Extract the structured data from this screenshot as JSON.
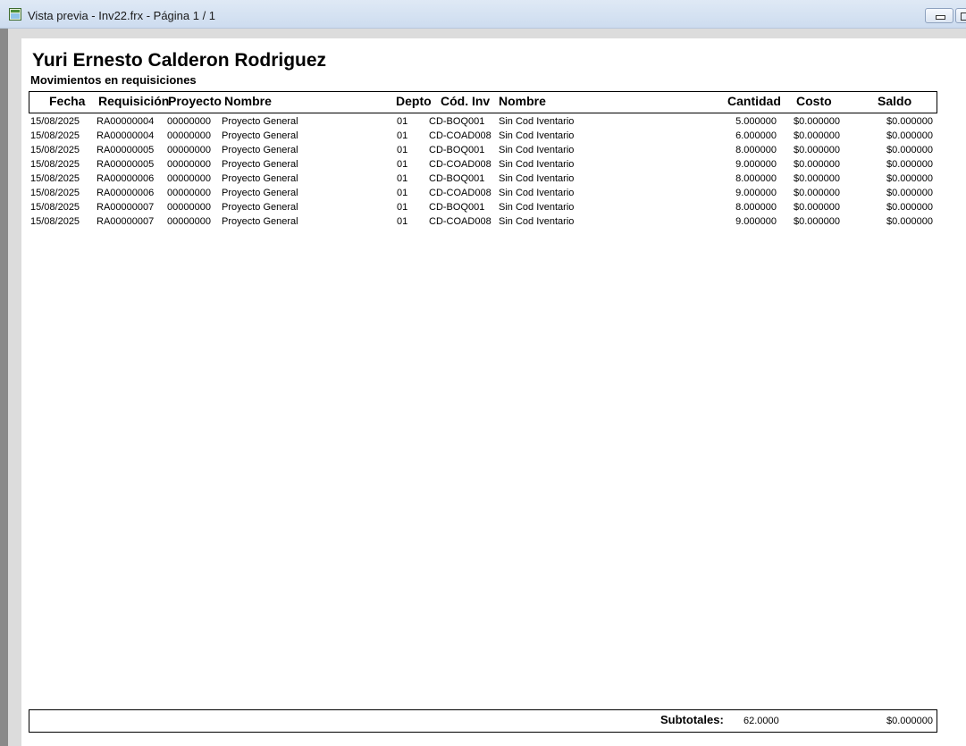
{
  "window": {
    "title": "Vista previa - Inv22.frx - Página 1 / 1",
    "app_icon": "report-icon",
    "frame_color": "#dcdcdc",
    "page_color": "#ffffff"
  },
  "report": {
    "title": "Yuri Ernesto Calderon Rodriguez",
    "subtitle": "Movimientos en requisiciones"
  },
  "columns": {
    "fecha": "Fecha",
    "requisicion": "Requisición",
    "proyecto": "Proyecto",
    "nombre": "Nombre",
    "depto": "Depto",
    "cod_inv": "Cód. Inv",
    "nombre2": "Nombre",
    "cantidad": "Cantidad",
    "costo": "Costo",
    "saldo": "Saldo"
  },
  "rows": [
    {
      "fecha": "15/08/2025",
      "requisicion": "RA00000004",
      "proyecto": "00000000",
      "nombre": "Proyecto General",
      "depto": "01",
      "cod_inv": "CD-BOQ001",
      "nombre2": "Sin Cod Iventario",
      "cantidad": "5.000000",
      "costo": "$0.000000",
      "saldo": "$0.000000"
    },
    {
      "fecha": "15/08/2025",
      "requisicion": "RA00000004",
      "proyecto": "00000000",
      "nombre": "Proyecto General",
      "depto": "01",
      "cod_inv": "CD-COAD008",
      "nombre2": "Sin Cod Iventario",
      "cantidad": "6.000000",
      "costo": "$0.000000",
      "saldo": "$0.000000"
    },
    {
      "fecha": "15/08/2025",
      "requisicion": "RA00000005",
      "proyecto": "00000000",
      "nombre": "Proyecto General",
      "depto": "01",
      "cod_inv": "CD-BOQ001",
      "nombre2": "Sin Cod Iventario",
      "cantidad": "8.000000",
      "costo": "$0.000000",
      "saldo": "$0.000000"
    },
    {
      "fecha": "15/08/2025",
      "requisicion": "RA00000005",
      "proyecto": "00000000",
      "nombre": "Proyecto General",
      "depto": "01",
      "cod_inv": "CD-COAD008",
      "nombre2": "Sin Cod Iventario",
      "cantidad": "9.000000",
      "costo": "$0.000000",
      "saldo": "$0.000000"
    },
    {
      "fecha": "15/08/2025",
      "requisicion": "RA00000006",
      "proyecto": "00000000",
      "nombre": "Proyecto General",
      "depto": "01",
      "cod_inv": "CD-BOQ001",
      "nombre2": "Sin Cod Iventario",
      "cantidad": "8.000000",
      "costo": "$0.000000",
      "saldo": "$0.000000"
    },
    {
      "fecha": "15/08/2025",
      "requisicion": "RA00000006",
      "proyecto": "00000000",
      "nombre": "Proyecto General",
      "depto": "01",
      "cod_inv": "CD-COAD008",
      "nombre2": "Sin Cod Iventario",
      "cantidad": "9.000000",
      "costo": "$0.000000",
      "saldo": "$0.000000"
    },
    {
      "fecha": "15/08/2025",
      "requisicion": "RA00000007",
      "proyecto": "00000000",
      "nombre": "Proyecto General",
      "depto": "01",
      "cod_inv": "CD-BOQ001",
      "nombre2": "Sin Cod Iventario",
      "cantidad": "8.000000",
      "costo": "$0.000000",
      "saldo": "$0.000000"
    },
    {
      "fecha": "15/08/2025",
      "requisicion": "RA00000007",
      "proyecto": "00000000",
      "nombre": "Proyecto General",
      "depto": "01",
      "cod_inv": "CD-COAD008",
      "nombre2": "Sin Cod Iventario",
      "cantidad": "9.000000",
      "costo": "$0.000000",
      "saldo": "$0.000000"
    }
  ],
  "subtotals": {
    "label": "Subtotales:",
    "cantidad": "62.0000",
    "saldo": "$0.000000"
  }
}
